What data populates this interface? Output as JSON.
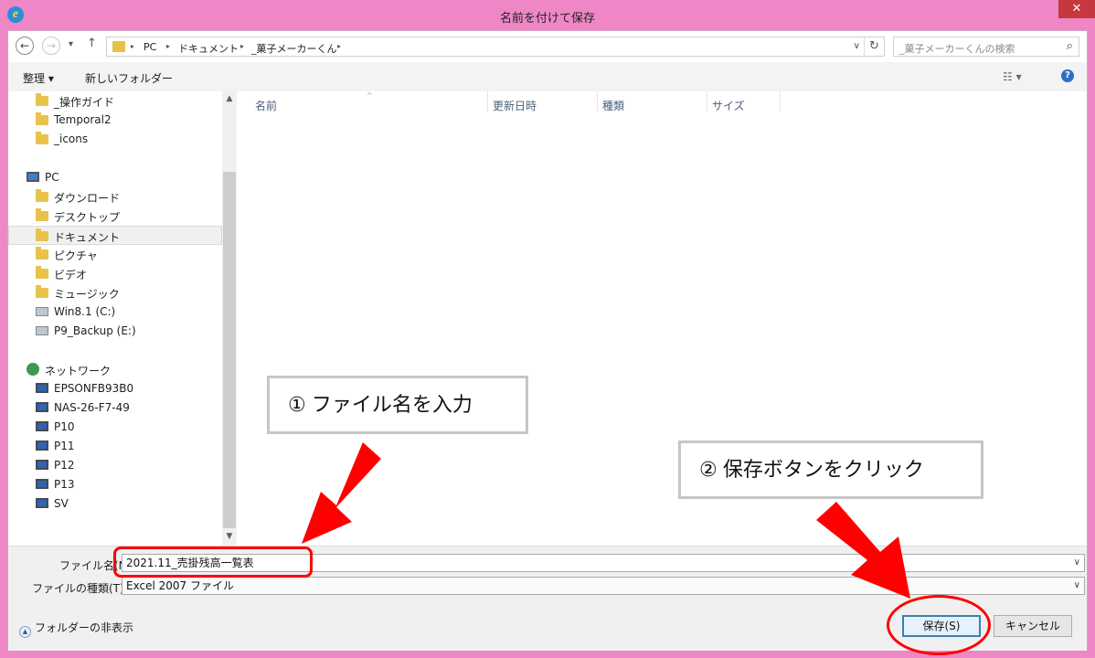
{
  "window": {
    "title": "名前を付けて保存",
    "close_glyph": "✕"
  },
  "nav": {
    "back_glyph": "←",
    "forward_glyph": "→",
    "history_glyph": "▾",
    "up_glyph": "↑",
    "breadcrumbs": [
      "PC",
      "ドキュメント",
      "_菓子メーカーくん"
    ],
    "crumb_sep": "▸",
    "dropdown_glyph": "∨",
    "refresh_glyph": "↻",
    "search_placeholder": "_菓子メーカーくんの検索",
    "search_glyph": "⌕"
  },
  "toolbar": {
    "organize": "整理 ▾",
    "new_folder": "新しいフォルダー",
    "view_glyph": "☷ ▾",
    "help_glyph": "?"
  },
  "tree": {
    "items": [
      {
        "label": "_操作ガイド",
        "icon": "folder-icon"
      },
      {
        "label": "Temporal2",
        "icon": "folder-icon"
      },
      {
        "label": "_icons",
        "icon": "folder-icon"
      },
      {
        "label": "PC",
        "icon": "pc-icon"
      },
      {
        "label": "ダウンロード",
        "icon": "downloads-folder-icon"
      },
      {
        "label": "デスクトップ",
        "icon": "desktop-folder-icon"
      },
      {
        "label": "ドキュメント",
        "icon": "documents-folder-icon",
        "selected": true
      },
      {
        "label": "ピクチャ",
        "icon": "pictures-folder-icon"
      },
      {
        "label": "ビデオ",
        "icon": "videos-folder-icon"
      },
      {
        "label": "ミュージック",
        "icon": "music-folder-icon"
      },
      {
        "label": "Win8.1 (C:)",
        "icon": "drive-icon"
      },
      {
        "label": "P9_Backup (E:)",
        "icon": "drive-icon"
      },
      {
        "label": "ネットワーク",
        "icon": "network-icon"
      },
      {
        "label": "EPSONFB93B0",
        "icon": "computer-icon"
      },
      {
        "label": "NAS-26-F7-49",
        "icon": "computer-icon"
      },
      {
        "label": "P10",
        "icon": "computer-icon"
      },
      {
        "label": "P11",
        "icon": "computer-icon"
      },
      {
        "label": "P12",
        "icon": "computer-icon"
      },
      {
        "label": "P13",
        "icon": "computer-icon"
      },
      {
        "label": "SV",
        "icon": "computer-icon"
      }
    ],
    "scroll_up_glyph": "▲",
    "scroll_down_glyph": "▼"
  },
  "columns": {
    "name": "名前",
    "modified": "更新日時",
    "type": "種類",
    "size": "サイズ",
    "sort_glyph": "^"
  },
  "form": {
    "filename_label": "ファイル名(N):",
    "filename_value": "2021.11_売掛残高一覧表",
    "filetype_label": "ファイルの種類(T):",
    "filetype_value": "Excel 2007 ファイル",
    "dropdown_glyph": "∨",
    "hide_folders": "フォルダーの非表示",
    "hide_glyph": "▲",
    "save": "保存(S)",
    "cancel": "キャンセル"
  },
  "annotations": {
    "step1": "① ファイル名を入力",
    "step2": "② 保存ボタンをクリック",
    "accent_color": "#ff0000"
  }
}
